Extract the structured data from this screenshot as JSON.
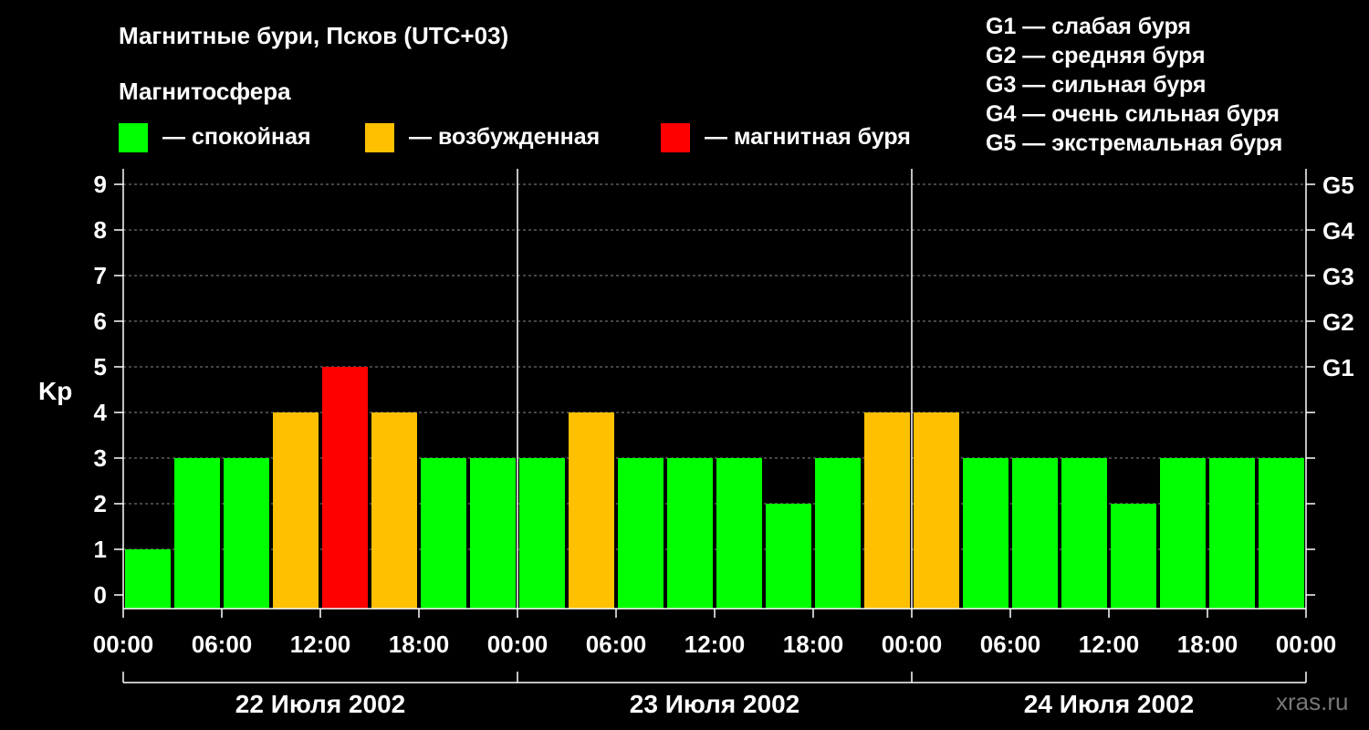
{
  "chart_data": {
    "type": "bar",
    "title": "Магнитные бури, Псков (UTC+03)",
    "subtitle": "Магнитосфера",
    "ylabel": "Kp",
    "ylim": [
      0,
      9
    ],
    "yticks": [
      "0",
      "1",
      "2",
      "3",
      "4",
      "5",
      "6",
      "7",
      "8",
      "9"
    ],
    "grid": true,
    "status_legend": [
      {
        "label": "— спокойная",
        "color": "#00ff00"
      },
      {
        "label": "— возбужденная",
        "color": "#ffc000"
      },
      {
        "label": "— магнитная буря",
        "color": "#ff0000"
      }
    ],
    "storm_levels_legend": [
      "G1 — слабая буря",
      "G2 — средняя буря",
      "G3 — сильная буря",
      "G4 — очень сильная буря",
      "G5 — экстремальная буря"
    ],
    "right_axis": [
      {
        "label": "G1",
        "kp": 5
      },
      {
        "label": "G2",
        "kp": 6
      },
      {
        "label": "G3",
        "kp": 7
      },
      {
        "label": "G4",
        "kp": 8
      },
      {
        "label": "G5",
        "kp": 9
      }
    ],
    "x_tick_labels": [
      "00:00",
      "06:00",
      "12:00",
      "18:00",
      "00:00",
      "06:00",
      "12:00",
      "18:00",
      "00:00",
      "06:00",
      "12:00",
      "18:00",
      "00:00"
    ],
    "days": [
      "22 Июля 2002",
      "23 Июля 2002",
      "24 Июля 2002"
    ],
    "interval_hours": 3,
    "values": [
      1,
      3,
      3,
      4,
      5,
      4,
      3,
      3,
      3,
      4,
      3,
      3,
      3,
      2,
      3,
      4,
      4,
      3,
      3,
      3,
      2,
      3,
      3,
      3
    ],
    "colors": {
      "quiet": "#00ff00",
      "unsettled": "#ffc000",
      "storm": "#ff0000"
    }
  },
  "watermark": "xras.ru"
}
